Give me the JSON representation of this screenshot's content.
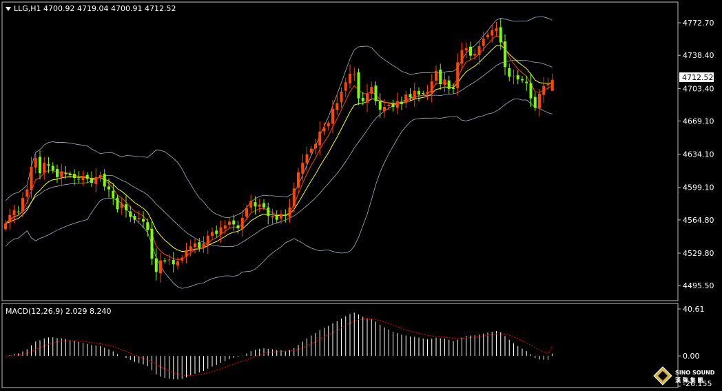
{
  "symbol_line": "LLG,H1  4700.92 4719.04 4700.91 4712.52",
  "price_tag": "4712.52",
  "macd_line": "MACD(12,26,9) 2.029 8.240",
  "logo": {
    "line1": "SINO SOUND",
    "line2": "漢 聲 集 團"
  },
  "colors": {
    "up": "#ff4500",
    "down": "#7cfc00",
    "ma_fast": "#ff4500",
    "ma_slow": "#ffff00",
    "bands": "#a3b1c6",
    "macd_hist": "#ffffff",
    "macd_signal": "#ff0000",
    "grid_frame": "#c0c0c0"
  },
  "chart_data": [
    {
      "type": "candlestick",
      "timeframe": "H1",
      "symbol": "LLG",
      "ohlc_last": {
        "open": 4700.92,
        "high": 4719.04,
        "low": 4700.91,
        "close": 4712.52
      },
      "yticks": [
        "4772.70",
        "4738.40",
        "4703.40",
        "4669.10",
        "4634.10",
        "4599.10",
        "4564.80",
        "4529.80",
        "4495.50"
      ],
      "ylim": [
        4484,
        4788
      ],
      "overlays": [
        "bollinger_bands",
        "moving_average_fast",
        "moving_average_slow"
      ],
      "closes": [
        4561,
        4570,
        4575,
        4573,
        4588,
        4597,
        4621,
        4630,
        4614,
        4625,
        4622,
        4617,
        4610,
        4616,
        4613,
        4612,
        4609,
        4608,
        4611,
        4608,
        4604,
        4610,
        4612,
        4600,
        4597,
        4588,
        4576,
        4582,
        4575,
        4568,
        4565,
        4567,
        4563,
        4554,
        4524,
        4510,
        4522,
        4521,
        4523,
        4518,
        4521,
        4525,
        4533,
        4537,
        4540,
        4535,
        4540,
        4548,
        4552,
        4550,
        4557,
        4559,
        4563,
        4560,
        4556,
        4567,
        4577,
        4585,
        4579,
        4581,
        4578,
        4569,
        4569,
        4565,
        4571,
        4569,
        4578,
        4598,
        4615,
        4625,
        4634,
        4640,
        4645,
        4658,
        4662,
        4667,
        4682,
        4688,
        4700,
        4710,
        4719,
        4719,
        4693,
        4690,
        4698,
        4705,
        4690,
        4681,
        4684,
        4686,
        4684,
        4690,
        4687,
        4697,
        4694,
        4701,
        4697,
        4698,
        4700,
        4711,
        4722,
        4708,
        4713,
        4703,
        4703,
        4731,
        4744,
        4746,
        4738,
        4740,
        4748,
        4756,
        4760,
        4765,
        4767,
        4752,
        4726,
        4716,
        4716,
        4713,
        4712,
        4709,
        4693,
        4683,
        4698,
        4706,
        4708,
        4712
      ],
      "macd_panel": {
        "name": "MACD(12,26,9)",
        "main": 2.029,
        "signal": 8.24,
        "yticks": [
          "40.61",
          "0.00",
          "-26.155"
        ],
        "ylim": [
          -26.155,
          40.61
        ]
      }
    }
  ]
}
